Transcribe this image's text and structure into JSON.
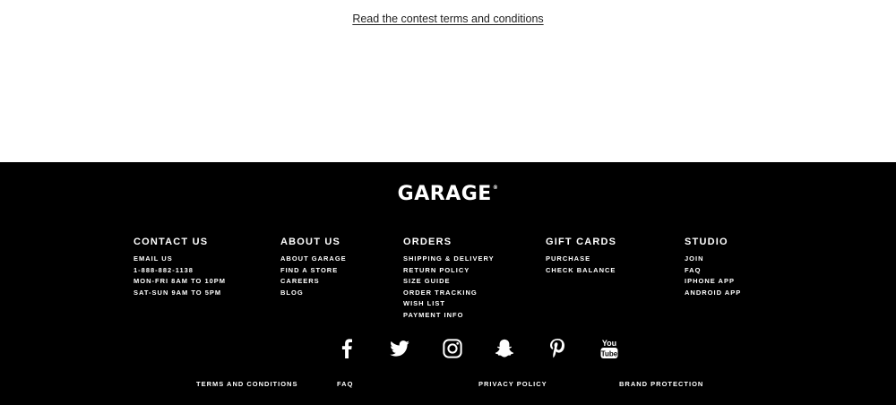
{
  "contest": {
    "link_text": "Read the contest terms and conditions"
  },
  "footer": {
    "logo": "GARAGE",
    "logo_mark": "®",
    "columns": [
      {
        "heading": "CONTACT US",
        "items": [
          "EMAIL US",
          "1-888-882-1138",
          "MON-FRI 8AM TO 10PM",
          "SAT-SUN 9AM TO 5PM"
        ]
      },
      {
        "heading": "ABOUT US",
        "items": [
          "ABOUT GARAGE",
          "FIND A STORE",
          "CAREERS",
          "BLOG"
        ]
      },
      {
        "heading": "ORDERS",
        "items": [
          "SHIPPING & DELIVERY",
          "RETURN POLICY",
          "SIZE GUIDE",
          "ORDER TRACKING",
          "WISH LIST",
          "PAYMENT INFO"
        ]
      },
      {
        "heading": "GIFT CARDS",
        "items": [
          "PURCHASE",
          "CHECK BALANCE"
        ]
      },
      {
        "heading": "STUDIO",
        "items": [
          "JOIN",
          "FAQ",
          "IPHONE APP",
          "ANDROID APP"
        ]
      }
    ],
    "social": [
      {
        "name": "facebook-icon"
      },
      {
        "name": "twitter-icon"
      },
      {
        "name": "instagram-icon"
      },
      {
        "name": "snapchat-icon"
      },
      {
        "name": "pinterest-icon"
      },
      {
        "name": "youtube-icon",
        "top_text": "You",
        "bottom_text": "Tube"
      }
    ],
    "bottom_links": [
      "TERMS AND CONDITIONS",
      "FAQ",
      "PRIVACY POLICY",
      "BRAND PROTECTION"
    ]
  },
  "colors": {
    "footer_bg": "#000000",
    "footer_text": "#ffffff",
    "page_bg": "#ffffff",
    "link_text": "#222222"
  }
}
